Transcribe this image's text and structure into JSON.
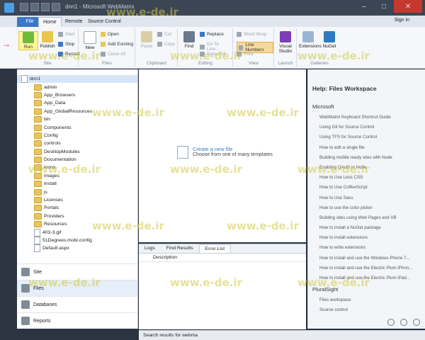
{
  "titlebar": {
    "title": "dnn1 - Microsoft WebMatrix",
    "signin": "Sign in"
  },
  "tabs": [
    "File",
    "Home",
    "Remote",
    "Source Control"
  ],
  "ribbon": {
    "site": {
      "label": "Site",
      "run": "Run",
      "publish": "Publish",
      "start": "Start",
      "stop": "Stop",
      "restart": "Restart"
    },
    "files": {
      "label": "Files",
      "new": "New",
      "open": "Open",
      "add_existing": "Add Existing",
      "close_all": "Close All"
    },
    "clipboard": {
      "label": "Clipboard",
      "paste": "Paste",
      "cut": "Cut",
      "copy": "Copy"
    },
    "editing": {
      "label": "Editing",
      "find": "Find",
      "replace": "Replace",
      "go_to_line": "Go To Line...",
      "select_all": "Select All"
    },
    "view": {
      "label": "View",
      "word_wrap": "Word Wrap",
      "line_numbers": "Line Numbers",
      "print": "Print"
    },
    "launch": {
      "label": "Launch",
      "visual_studio": "Visual Studio"
    },
    "galleries": {
      "label": "Galleries",
      "extensions": "Extensions",
      "nuget": "NuGet"
    }
  },
  "tree": {
    "root": "dnn1",
    "folders": [
      "admin",
      "App_Browsers",
      "App_Data",
      "App_GlobalResources",
      "bin",
      "Components",
      "Config",
      "controls",
      "DesktopModules",
      "Documentation",
      "Icons",
      "images",
      "Install",
      "js",
      "Licenses",
      "Portals",
      "Providers",
      "Resources"
    ],
    "files": [
      "403-3.gif",
      "51Degrees.mobi.config",
      "Default.aspx"
    ]
  },
  "nav": [
    "Site",
    "Files",
    "Databases",
    "Reports"
  ],
  "center": {
    "create_new": "Create a new file",
    "choose": "Choose from one of many templates"
  },
  "bottom": {
    "tabs": [
      "Logs",
      "Find Results",
      "Error List"
    ],
    "column": "Description"
  },
  "help": {
    "title": "Help: Files Workspace",
    "microsoft": "Microsoft",
    "links": [
      "WebMatrix Keyboard Shortcut Guide",
      "Using Git for Source Control",
      "Using TFS for Source Control",
      "How to edit a single file",
      "Building mobile ready sites with Node",
      "Enabling OAuth in Node",
      "How to Use Less CSS",
      "How to Use CoffeeScript",
      "How to Use Sass",
      "How to use the color picker",
      "Building sites using Web Pages and VB",
      "How to install a NuGet package",
      "How to install extensions",
      "How to write extensions",
      "How to install and use the Windows Phone 7...",
      "How to install and use the Electric Plum iPhon...",
      "How to install and use the Electric Plum iPad..."
    ],
    "pluralsight": "PluralSight",
    "ps_links": [
      "Files workspace",
      "Source control"
    ]
  },
  "status": {
    "text": "Search results for webma"
  },
  "watermark": "www.e-de.ir"
}
